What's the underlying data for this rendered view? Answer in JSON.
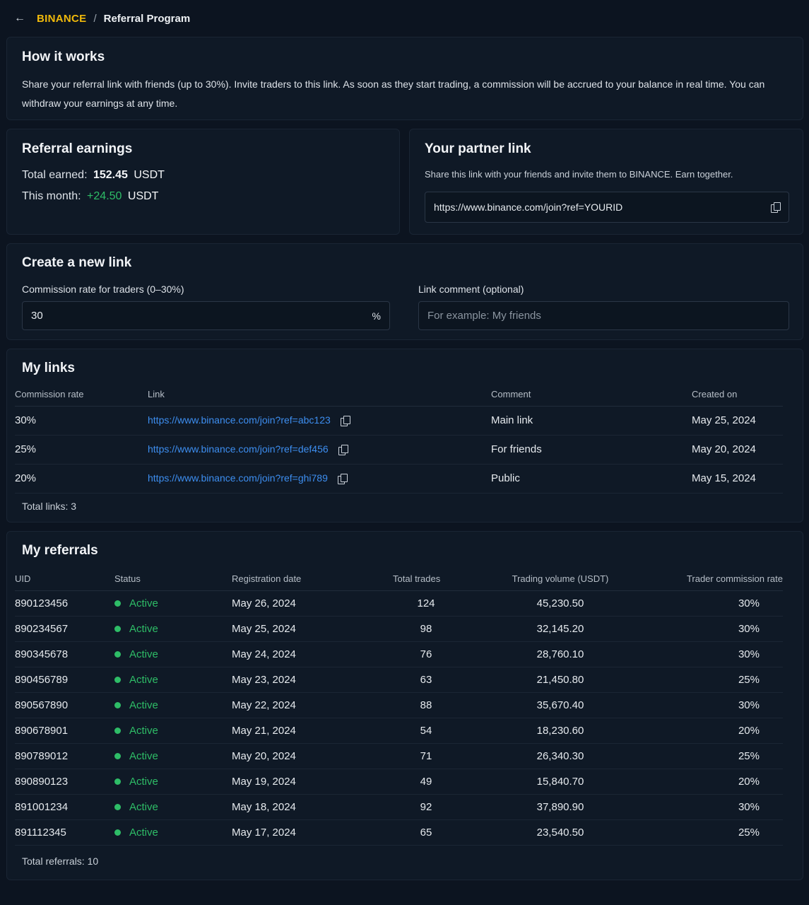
{
  "breadcrumb": {
    "brand": "BINANCE",
    "separator": "/",
    "current": "Referral Program"
  },
  "how_it_works": {
    "title": "How it works",
    "text": "Share your referral link with friends (up to 30%). Invite traders to this link. As soon as they start trading, a commission will be accrued to your balance in real time. You can withdraw your earnings at any time."
  },
  "earnings": {
    "title": "Referral earnings",
    "total_label": "Total earned:",
    "total_value": "152.45",
    "total_unit": "USDT",
    "month_label": "This month:",
    "month_value": "+24.50",
    "month_unit": "USDT"
  },
  "partner": {
    "title": "Your partner link",
    "description": "Share this link with your friends and invite them to BINANCE. Earn together.",
    "url": "https://www.binance.com/join?ref=YOURID"
  },
  "create": {
    "title": "Create a new link",
    "rate_label": "Commission rate for traders (0–30%)",
    "rate_value": "30",
    "rate_suffix": "%",
    "comment_label": "Link comment (optional)",
    "comment_placeholder": "For example: My friends"
  },
  "my_links": {
    "title": "My links",
    "columns": [
      "Commission rate",
      "Link",
      "Comment",
      "Created on"
    ],
    "rows": [
      {
        "rate": "30%",
        "url": "https://www.binance.com/join?ref=abc123",
        "comment": "Main link",
        "created": "May 25, 2024"
      },
      {
        "rate": "25%",
        "url": "https://www.binance.com/join?ref=def456",
        "comment": "For friends",
        "created": "May 20, 2024"
      },
      {
        "rate": "20%",
        "url": "https://www.binance.com/join?ref=ghi789",
        "comment": "Public",
        "created": "May 15, 2024"
      }
    ],
    "total": "Total links: 3"
  },
  "my_referrals": {
    "title": "My referrals",
    "columns": [
      "UID",
      "Status",
      "Registration date",
      "Total trades",
      "Trading volume (USDT)",
      "Trader commission rate"
    ],
    "rows": [
      {
        "uid": "890123456",
        "status": "Active",
        "date": "May 26, 2024",
        "trades": "124",
        "volume": "45,230.50",
        "rate": "30%"
      },
      {
        "uid": "890234567",
        "status": "Active",
        "date": "May 25, 2024",
        "trades": "98",
        "volume": "32,145.20",
        "rate": "30%"
      },
      {
        "uid": "890345678",
        "status": "Active",
        "date": "May 24, 2024",
        "trades": "76",
        "volume": "28,760.10",
        "rate": "30%"
      },
      {
        "uid": "890456789",
        "status": "Active",
        "date": "May 23, 2024",
        "trades": "63",
        "volume": "21,450.80",
        "rate": "25%"
      },
      {
        "uid": "890567890",
        "status": "Active",
        "date": "May 22, 2024",
        "trades": "88",
        "volume": "35,670.40",
        "rate": "30%"
      },
      {
        "uid": "890678901",
        "status": "Active",
        "date": "May 21, 2024",
        "trades": "54",
        "volume": "18,230.60",
        "rate": "20%"
      },
      {
        "uid": "890789012",
        "status": "Active",
        "date": "May 20, 2024",
        "trades": "71",
        "volume": "26,340.30",
        "rate": "25%"
      },
      {
        "uid": "890890123",
        "status": "Active",
        "date": "May 19, 2024",
        "trades": "49",
        "volume": "15,840.70",
        "rate": "20%"
      },
      {
        "uid": "891001234",
        "status": "Active",
        "date": "May 18, 2024",
        "trades": "92",
        "volume": "37,890.90",
        "rate": "30%"
      },
      {
        "uid": "891112345",
        "status": "Active",
        "date": "May 17, 2024",
        "trades": "65",
        "volume": "23,540.50",
        "rate": "25%"
      }
    ],
    "total": "Total referrals: 10"
  },
  "colors": {
    "brand": "#f0b90b",
    "positive": "#2ebd67",
    "link": "#3d8ef0",
    "background": "#0c1420",
    "card": "#0f1926"
  },
  "icons": {
    "back": "arrow-left-icon",
    "copy": "copy-icon",
    "status": "status-dot-icon"
  }
}
